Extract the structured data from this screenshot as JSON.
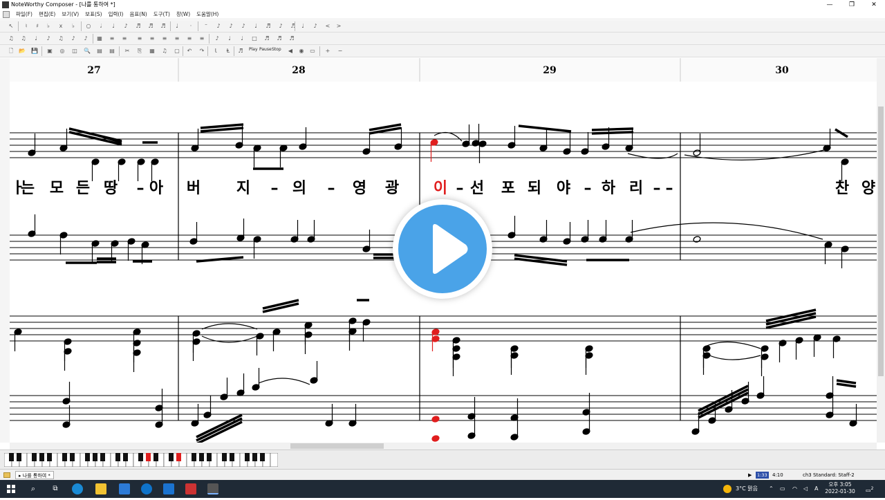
{
  "window": {
    "title": "NoteWorthy Composer - [나를 통하여 *]",
    "controls": {
      "minimize": "—",
      "restore": "❐",
      "close": "✕"
    }
  },
  "menu": [
    "파일(F)",
    "편집(E)",
    "보기(V)",
    "보표(S)",
    "입력(I)",
    "음표(N)",
    "도구(T)",
    "창(W)",
    "도움말(H)"
  ],
  "toolbar": {
    "play_label": "Play",
    "pause_label": "Pause",
    "stop_label": "Stop"
  },
  "score": {
    "measure_numbers": [
      "27",
      "28",
      "29",
      "30"
    ],
    "lyrics": [
      "는",
      "모",
      "든",
      "땅",
      "–",
      "아",
      "버",
      "지",
      "–",
      "의",
      "–",
      "영",
      "광",
      "이",
      "–",
      "선",
      "포",
      "되",
      "야",
      "–",
      "하",
      "리",
      "–",
      "–",
      "찬",
      "양"
    ],
    "lyric_partial": "ㅏ",
    "highlight_lyric": "이",
    "highlight_color": "#e01e1e",
    "cursor_color": "#1b2fb5"
  },
  "status": {
    "tab_label": "나를 통하여 *",
    "time_position": "1:33",
    "time_total": "4:10",
    "staff_info": "ch3 Standard: Staff-2"
  },
  "taskbar": {
    "weather": "3°C 맑음",
    "ime": "A",
    "clock_time": "오후 3:05",
    "clock_date": "2022-01-30",
    "notify_count": "2"
  },
  "colors": {
    "accent": "#4aa3e8",
    "taskbar": "#1f2a36"
  }
}
